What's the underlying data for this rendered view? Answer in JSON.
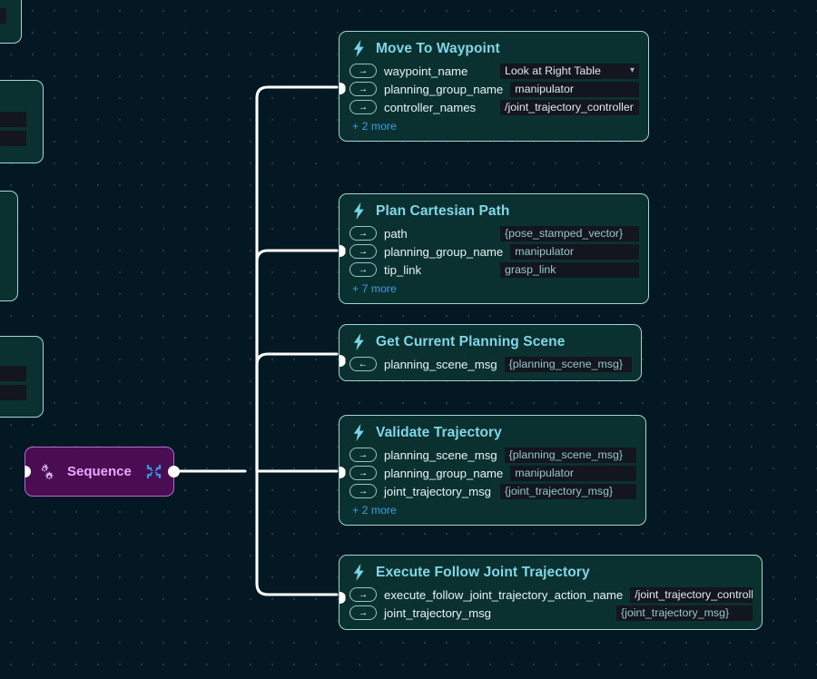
{
  "canvas": {
    "background_color": "#041824",
    "grid_dot_color": "#8caab9",
    "edge_color": "#ffffff"
  },
  "sequence_node": {
    "label": "Sequence",
    "icon_left": "gears-icon",
    "icon_right": "collapse-icon",
    "fill_color": "#4a0d52",
    "border_color": "#b06fd0",
    "label_color": "#e7a8ff"
  },
  "nodes": [
    {
      "title": "Move To Waypoint",
      "icon": "lightning-bolt-icon",
      "params": [
        {
          "direction": "in",
          "arrow": "→",
          "name": "waypoint_name",
          "value": "Look at Right Table",
          "is_template": false,
          "has_dropdown": true
        },
        {
          "direction": "in",
          "arrow": "→",
          "name": "planning_group_name",
          "value": "manipulator",
          "is_template": false,
          "has_dropdown": false
        },
        {
          "direction": "in",
          "arrow": "→",
          "name": "controller_names",
          "value": "/joint_trajectory_controller",
          "is_template": false,
          "has_dropdown": false
        }
      ],
      "more_label": "+ 2 more"
    },
    {
      "title": "Plan Cartesian Path",
      "icon": "lightning-bolt-icon",
      "params": [
        {
          "direction": "in",
          "arrow": "→",
          "name": "path",
          "value": "{pose_stamped_vector}",
          "is_template": true,
          "has_dropdown": false
        },
        {
          "direction": "in",
          "arrow": "→",
          "name": "planning_group_name",
          "value": "manipulator",
          "is_template": false,
          "has_dropdown": false
        },
        {
          "direction": "in",
          "arrow": "→",
          "name": "tip_link",
          "value": "grasp_link",
          "is_template": false,
          "has_dropdown": false
        }
      ],
      "more_label": "+ 7 more"
    },
    {
      "title": "Get Current Planning Scene",
      "icon": "lightning-bolt-icon",
      "params": [
        {
          "direction": "out",
          "arrow": "←",
          "name": "planning_scene_msg",
          "value": "{planning_scene_msg}",
          "is_template": true,
          "has_dropdown": false
        }
      ],
      "more_label": ""
    },
    {
      "title": "Validate Trajectory",
      "icon": "lightning-bolt-icon",
      "params": [
        {
          "direction": "in",
          "arrow": "→",
          "name": "planning_scene_msg",
          "value": "{planning_scene_msg}",
          "is_template": true,
          "has_dropdown": false
        },
        {
          "direction": "in",
          "arrow": "→",
          "name": "planning_group_name",
          "value": "manipulator",
          "is_template": false,
          "has_dropdown": false
        },
        {
          "direction": "in",
          "arrow": "→",
          "name": "joint_trajectory_msg",
          "value": "{joint_trajectory_msg}",
          "is_template": true,
          "has_dropdown": false
        }
      ],
      "more_label": "+ 2 more"
    },
    {
      "title": "Execute Follow Joint Trajectory",
      "icon": "lightning-bolt-icon",
      "params": [
        {
          "direction": "in",
          "arrow": "→",
          "name": "execute_follow_joint_trajectory_action_name",
          "value": "/joint_trajectory_controller/fol",
          "is_template": false,
          "has_dropdown": false
        },
        {
          "direction": "in",
          "arrow": "→",
          "name": "joint_trajectory_msg",
          "value": "{joint_trajectory_msg}",
          "is_template": true,
          "has_dropdown": false
        }
      ],
      "more_label": ""
    }
  ],
  "offscreen_nodes": [
    {
      "partial_text": ""
    },
    {
      "partial_text": "}"
    },
    {
      "partial_text": ""
    },
    {
      "partial_text": "}"
    }
  ]
}
